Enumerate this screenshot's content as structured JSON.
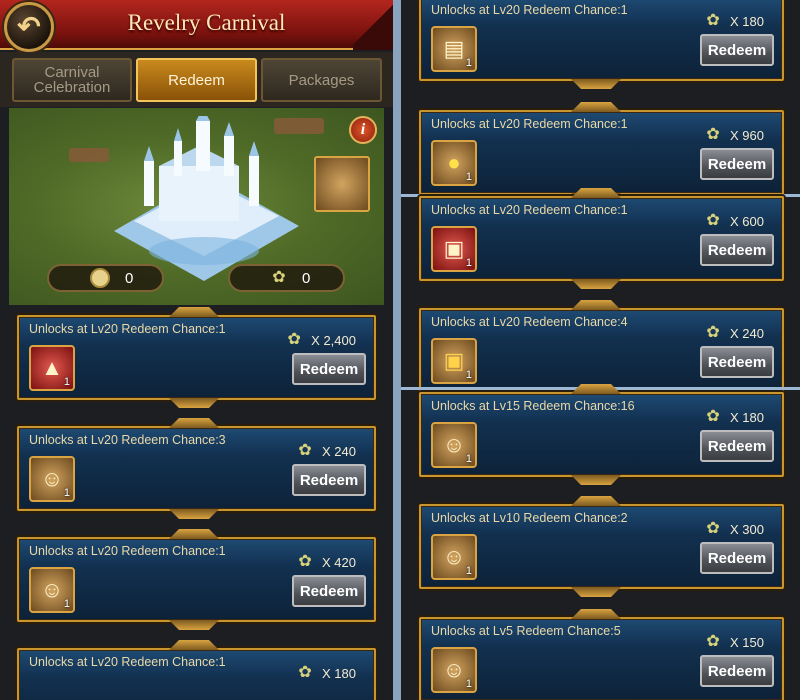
{
  "header": {
    "title": "Revelry Carnival",
    "back_icon": "back-arrow-icon"
  },
  "tabs": [
    {
      "label": "Carnival Celebration",
      "active": false
    },
    {
      "label": "Redeem",
      "active": true
    },
    {
      "label": "Packages",
      "active": false
    }
  ],
  "banner": {
    "coin_count": "0",
    "token_count": "0",
    "info_symbol": "i"
  },
  "left_cards": [
    {
      "unlock": "Unlocks at Lv20 Redeem Chance:1",
      "cost": "X 2,400",
      "qty": "1",
      "button": "Redeem",
      "item_icon": "castle-icon"
    },
    {
      "unlock": "Unlocks at Lv20 Redeem Chance:3",
      "cost": "X 240",
      "qty": "1",
      "button": "Redeem",
      "item_icon": "scroll-portrait-icon"
    },
    {
      "unlock": "Unlocks at Lv20 Redeem Chance:1",
      "cost": "X 420",
      "qty": "1",
      "button": "Redeem",
      "item_icon": "scroll-portrait-icon"
    },
    {
      "unlock": "Unlocks at Lv20 Redeem Chance:1",
      "cost": "X 180",
      "qty": "",
      "button": "",
      "item_icon": ""
    }
  ],
  "right_cards": [
    {
      "unlock": "Unlocks at Lv20 Redeem Chance:1",
      "cost": "X 180",
      "qty": "1",
      "button": "Redeem",
      "item_icon": "scroll-icon"
    },
    {
      "unlock": "Unlocks at Lv20 Redeem Chance:1",
      "cost": "X 960",
      "qty": "1",
      "button": "Redeem",
      "item_icon": "gold-pile-icon"
    },
    {
      "unlock": "Unlocks at Lv20 Redeem Chance:1",
      "cost": "X 600",
      "qty": "1",
      "button": "Redeem",
      "item_icon": "red-chest-icon"
    },
    {
      "unlock": "Unlocks at Lv20 Redeem Chance:4",
      "cost": "X 240",
      "qty": "1",
      "button": "Redeem",
      "item_icon": "gold-chest-icon"
    },
    {
      "unlock": "Unlocks at Lv15 Redeem Chance:16",
      "cost": "X 180",
      "qty": "1",
      "button": "Redeem",
      "item_icon": "scroll-portrait-icon"
    },
    {
      "unlock": "Unlocks at Lv10 Redeem Chance:2",
      "cost": "X 300",
      "qty": "1",
      "button": "Redeem",
      "item_icon": "scroll-portrait-icon"
    },
    {
      "unlock": "Unlocks at Lv5 Redeem Chance:5",
      "cost": "X 150",
      "qty": "1",
      "button": "Redeem",
      "item_icon": "scroll-portrait-icon"
    }
  ],
  "colors": {
    "card_border": "#c7962f",
    "header_red": "#b3261e",
    "tab_active": "#c98a1e"
  }
}
